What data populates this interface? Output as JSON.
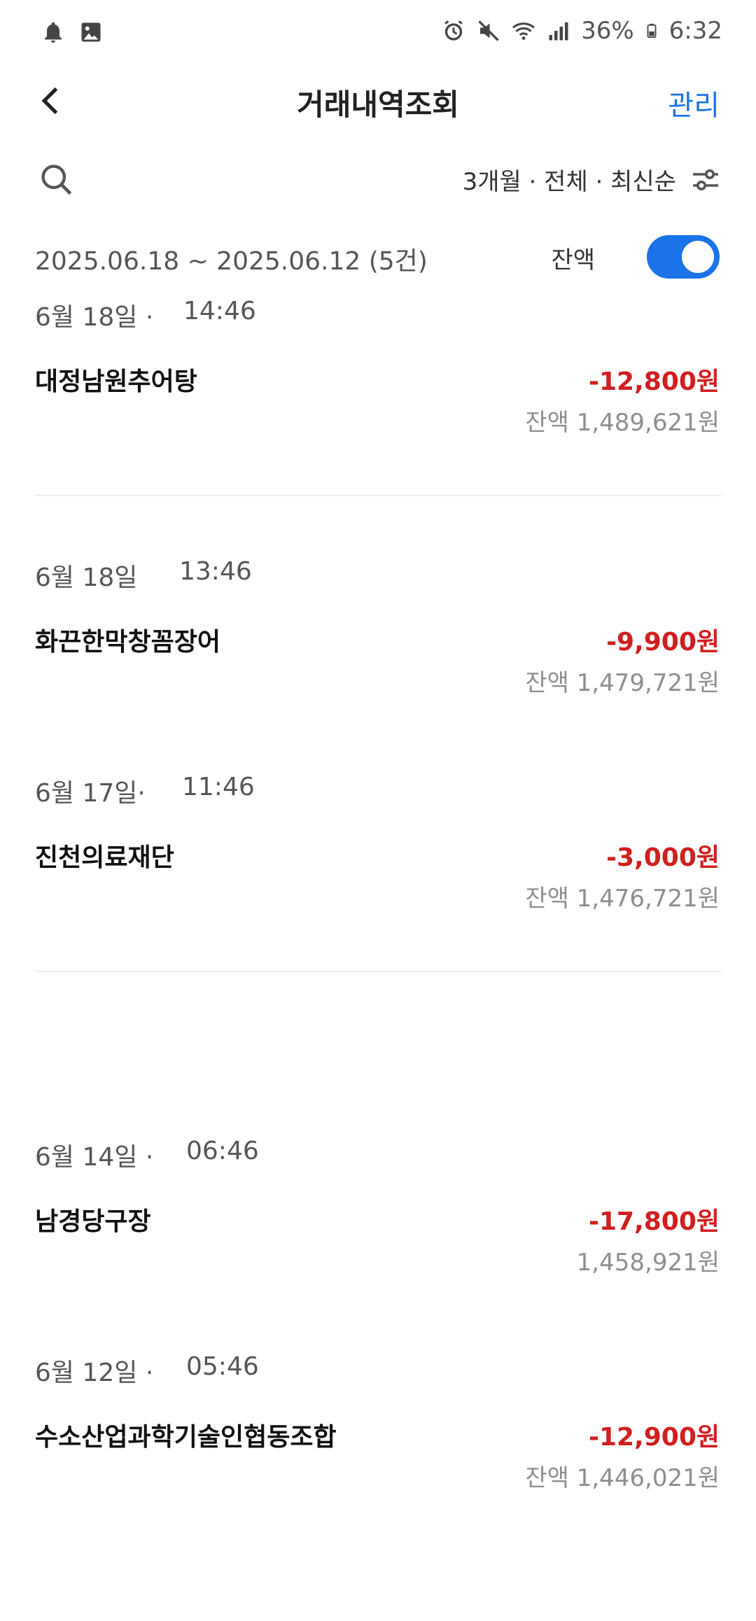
{
  "status_bar": {
    "left_icons": [
      "bell-icon",
      "image-icon"
    ],
    "right_icons": [
      "alarm-icon",
      "mute-icon",
      "wifi-icon",
      "signal-icon",
      "battery-icon"
    ],
    "battery": "36%",
    "time": "6:32"
  },
  "header": {
    "title": "거래내역조회",
    "manage_label": "관리"
  },
  "filter": {
    "summary": "3개월 · 전체 · 최신순"
  },
  "range": {
    "text": "2025.06.18 ~ 2025.06.12 (5건)",
    "balance_toggle_label": "잔액",
    "balance_toggle_on": true
  },
  "transactions": [
    {
      "date": "6월 18일 ·",
      "time": "14:46",
      "merchant": "대정남원추어탕",
      "amount": "-12,800원",
      "balance": "잔액 1,489,621원"
    },
    {
      "date": "6월 18일",
      "time": "13:46",
      "merchant": "화끈한막창꼼장어",
      "amount": "-9,900원",
      "balance": "잔액 1,479,721원"
    },
    {
      "date": "6월 17일·",
      "time": "11:46",
      "merchant": "진천의료재단",
      "amount": "-3,000원",
      "balance": "잔액 1,476,721원"
    },
    {
      "date": "6월 14일 ·",
      "time": "06:46",
      "merchant": "남경당구장",
      "amount": "-17,800원",
      "balance": "1,458,921원"
    },
    {
      "date": "6월 12일 ·",
      "time": "05:46",
      "merchant": "수소산업과학기술인협동조합",
      "amount": "-12,900원",
      "balance": "잔액 1,446,021원"
    }
  ],
  "colors": {
    "accent": "#1a73e8",
    "negative": "#d01f1f"
  }
}
